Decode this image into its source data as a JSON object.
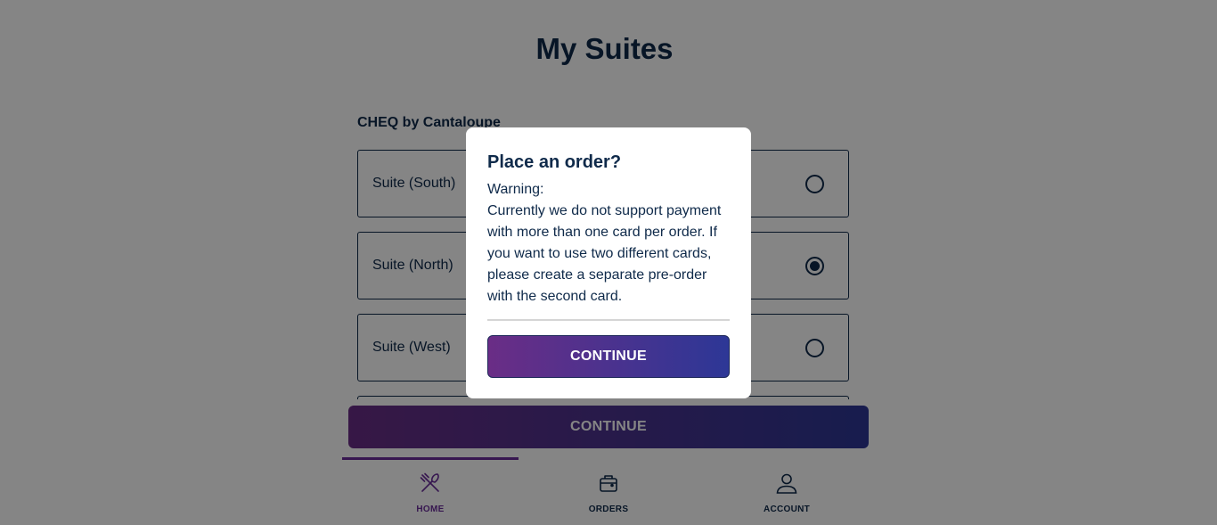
{
  "page": {
    "title": "My Suites",
    "venue": "CHEQ by Cantaloupe"
  },
  "suites": [
    {
      "label": "Suite (South)",
      "selected": false
    },
    {
      "label": "Suite (North)",
      "selected": true
    },
    {
      "label": "Suite (West)",
      "selected": false
    }
  ],
  "footer": {
    "continue_label": "CONTINUE"
  },
  "nav": {
    "items": [
      {
        "label": "HOME",
        "icon": "utensils-icon",
        "active": true
      },
      {
        "label": "ORDERS",
        "icon": "bag-icon",
        "active": false
      },
      {
        "label": "ACCOUNT",
        "icon": "user-icon",
        "active": false
      }
    ]
  },
  "modal": {
    "title": "Place an order?",
    "warning_heading": "Warning:",
    "warning_text": "Currently we do not support payment with more than one card per order. If you want to use two different cards, please create a separate pre-order with the second card.",
    "continue_label": "CONTINUE"
  },
  "colors": {
    "primary_text": "#0f2a4a",
    "accent_purple": "#6a2d9a",
    "button_gradient_start": "#6a2d86",
    "button_gradient_end": "#2d3796",
    "overlay": "rgba(0,0,0,0.48)"
  }
}
